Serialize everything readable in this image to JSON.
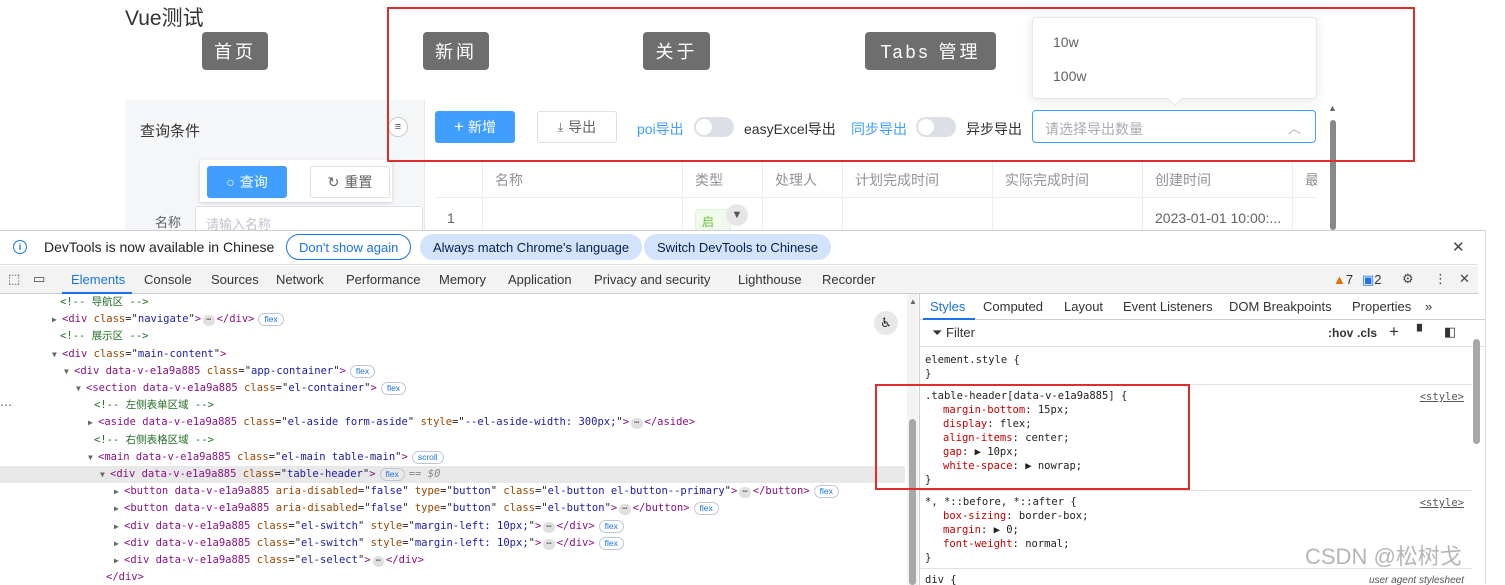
{
  "app": {
    "title": "Vue测试",
    "nav": [
      "首页",
      "新闻",
      "关于",
      "Tabs 管理"
    ],
    "aside": {
      "label": "查询条件",
      "toggle_icon": "≡",
      "search_label": "查询",
      "reset_label": "重置",
      "name_label": "名称",
      "name_placeholder": "请输入名称"
    },
    "toolbar": {
      "add_label": "新增",
      "export_label": "导出",
      "switch1_left": "poi导出",
      "switch1_right": "easyExcel导出",
      "switch2_left": "同步导出",
      "switch2_right": "异步导出",
      "select_placeholder": "请选择导出数量",
      "dropdown_options": [
        "10w",
        "100w"
      ]
    },
    "table": {
      "headers": [
        "",
        "名称",
        "类型",
        "处理人",
        "计划完成时间",
        "实际完成时间",
        "创建时间",
        "最"
      ],
      "row": [
        "1",
        "",
        "启用",
        "",
        "",
        "",
        "2023-01-01 10:00:..."
      ]
    },
    "accent_color": "#409eff",
    "highlight_color": "#d9302f"
  },
  "devtools": {
    "info": {
      "text": "DevTools is now available in Chinese",
      "btn_dont_show": "Don't show again",
      "btn_match": "Always match Chrome's language",
      "btn_switch": "Switch DevTools to Chinese"
    },
    "tabs": [
      "Elements",
      "Console",
      "Sources",
      "Network",
      "Performance",
      "Memory",
      "Application",
      "Privacy and security",
      "Lighthouse",
      "Recorder"
    ],
    "warnings": "7",
    "issues": "2",
    "tree": [
      {
        "type": "comment",
        "text": "<!-- 导航区 -->"
      },
      {
        "type": "node",
        "open": "<div",
        "attrs": [
          [
            "class",
            "navigate"
          ]
        ],
        "close": ">",
        "collapsed": true,
        "end": "</div>",
        "chip": "flex"
      },
      {
        "type": "comment",
        "text": "<!-- 展示区 -->"
      },
      {
        "type": "node",
        "open": "<div",
        "attrs": [
          [
            "class",
            "main-content"
          ]
        ],
        "close": ">"
      },
      {
        "type": "node",
        "open": "<div data-v-e1a9a885",
        "attrs": [
          [
            "class",
            "app-container"
          ]
        ],
        "close": ">",
        "chip": "flex"
      },
      {
        "type": "node",
        "open": "<section data-v-e1a9a885",
        "attrs": [
          [
            "class",
            "el-container"
          ]
        ],
        "close": ">",
        "chip": "flex"
      },
      {
        "type": "comment",
        "text": "<!-- 左侧表单区域 -->"
      },
      {
        "type": "node",
        "open": "<aside data-v-e1a9a885",
        "attrs": [
          [
            "class",
            "el-aside form-aside"
          ],
          [
            "style",
            "--el-aside-width: 300px;"
          ]
        ],
        "close": ">",
        "collapsed": true,
        "end": "</aside>"
      },
      {
        "type": "comment",
        "text": "<!-- 右侧表格区域 -->"
      },
      {
        "type": "node",
        "open": "<main data-v-e1a9a885",
        "attrs": [
          [
            "class",
            "el-main table-main"
          ]
        ],
        "close": ">",
        "chip": "scroll"
      },
      {
        "type": "node",
        "open": "<div data-v-e1a9a885",
        "attrs": [
          [
            "class",
            "table-header"
          ]
        ],
        "close": ">",
        "chip": "flex",
        "selected": true,
        "dollar": "== $0"
      },
      {
        "type": "node",
        "open": "<button data-v-e1a9a885",
        "attrs": [
          [
            "aria-disabled",
            "false"
          ],
          [
            "type",
            "button"
          ],
          [
            "class",
            "el-button el-button--primary"
          ]
        ],
        "close": ">",
        "collapsed": true,
        "end": "</button>",
        "chip": "flex"
      },
      {
        "type": "node",
        "open": "<button data-v-e1a9a885",
        "attrs": [
          [
            "aria-disabled",
            "false"
          ],
          [
            "type",
            "button"
          ],
          [
            "class",
            "el-button"
          ]
        ],
        "close": ">",
        "collapsed": true,
        "end": "</button>",
        "chip": "flex"
      },
      {
        "type": "node",
        "open": "<div data-v-e1a9a885",
        "attrs": [
          [
            "class",
            "el-switch"
          ],
          [
            "style",
            "margin-left: 10px;"
          ]
        ],
        "close": ">",
        "collapsed": true,
        "end": "</div>",
        "chip": "flex"
      },
      {
        "type": "node",
        "open": "<div data-v-e1a9a885",
        "attrs": [
          [
            "class",
            "el-switch"
          ],
          [
            "style",
            "margin-left: 10px;"
          ]
        ],
        "close": ">",
        "collapsed": true,
        "end": "</div>",
        "chip": "flex"
      },
      {
        "type": "node",
        "open": "<div data-v-e1a9a885",
        "attrs": [
          [
            "class",
            "el-select"
          ]
        ],
        "close": ">",
        "collapsed": true,
        "end": "</div>"
      },
      {
        "type": "closing",
        "text": "</div>"
      }
    ],
    "styles_tabs": [
      "Styles",
      "Computed",
      "Layout",
      "Event Listeners",
      "DOM Breakpoints",
      "Properties",
      "»"
    ],
    "filter_label": "Filter",
    "hov": ":hov",
    "cls": ".cls",
    "rules": [
      {
        "selector": "element.style {",
        "props": [],
        "source": ""
      },
      {
        "selector": ".table-header[data-v-e1a9a885] {",
        "props": [
          [
            "margin-bottom",
            "15px;"
          ],
          [
            "display",
            "flex;"
          ],
          [
            "align-items",
            "center;"
          ],
          [
            "gap",
            "▶ 10px;"
          ],
          [
            "white-space",
            "▶ nowrap;"
          ]
        ],
        "source": "<style>"
      },
      {
        "selector": "*, *::before, *::after {",
        "props": [
          [
            "box-sizing",
            "border-box;"
          ],
          [
            "margin",
            "▶ 0;"
          ],
          [
            "font-weight",
            "normal;"
          ]
        ],
        "source": "<style>"
      },
      {
        "selector": "div {",
        "props": [],
        "source": "user agent stylesheet"
      }
    ],
    "watermark": "CSDN @松树戈"
  }
}
